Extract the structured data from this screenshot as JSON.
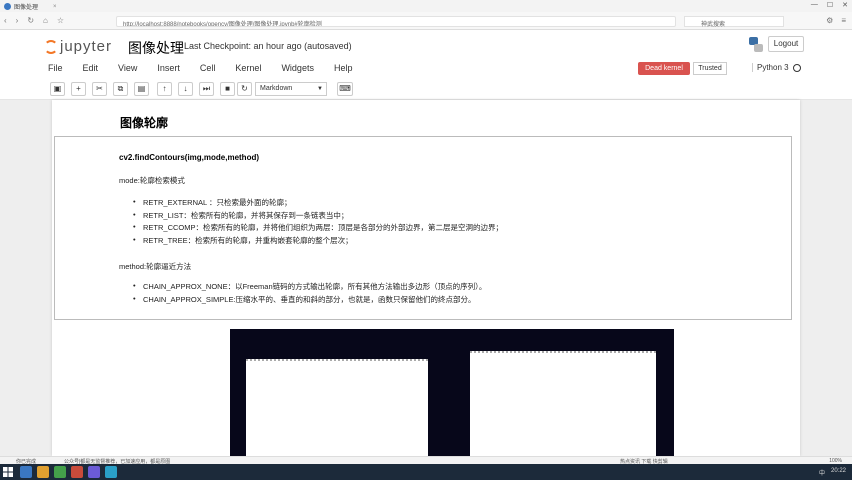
{
  "browser": {
    "tab_title": "图像处理",
    "url": "http://localhost:8888/notebooks/opencv/图像处理/图像处理.ipynb#轮廓检测",
    "search_placeholder": "神武搜索",
    "tab_close": "×",
    "win_min": "—",
    "win_max": "☐",
    "win_close": "✕"
  },
  "header": {
    "logo_text": "jupyter",
    "notebook_title": "图像处理",
    "checkpoint": "Last Checkpoint: an hour ago (autosaved)",
    "logout_label": "Logout"
  },
  "menubar": {
    "items": [
      "File",
      "Edit",
      "View",
      "Insert",
      "Cell",
      "Kernel",
      "Widgets",
      "Help"
    ],
    "dead_kernel": "Dead kernel",
    "trusted": "Trusted",
    "kernel_name": "Python 3"
  },
  "toolbar": {
    "cell_type": "Markdown"
  },
  "notebook": {
    "heading": "图像轮廓",
    "signature": "cv2.findContours(img,mode,method)",
    "mode_label": "mode:轮廓检索模式",
    "mode_items": [
      "RETR_EXTERNAL ：只检索最外面的轮廓；",
      "RETR_LIST：检索所有的轮廓，并将其保存到一条链表当中；",
      "RETR_CCOMP：检索所有的轮廓，并将他们组织为两层：顶层是各部分的外部边界，第二层是空洞的边界；",
      "RETR_TREE：检索所有的轮廓，并重构嵌套轮廓的整个层次；"
    ],
    "method_label": "method:轮廓逼近方法",
    "method_items": [
      "CHAIN_APPROX_NONE：以Freeman链码的方式输出轮廓，所有其他方法输出多边形（顶点的序列）。",
      "CHAIN_APPROX_SIMPLE:压缩水平的、垂直的和斜的部分，也就是，函数只保留他们的终点部分。"
    ]
  },
  "statusbar": {
    "left": "你已完成",
    "middle": "公众号|都是无监督推荐，已加速应用，都是原图",
    "right": "热点资讯  下载  快剪辑",
    "zoom": "100%"
  },
  "taskbar": {
    "time": "20:22",
    "lang": "中"
  },
  "colors": {
    "accent": "#f37726",
    "dead_kernel_bg": "#d9534f",
    "output_bg": "#07071a"
  }
}
